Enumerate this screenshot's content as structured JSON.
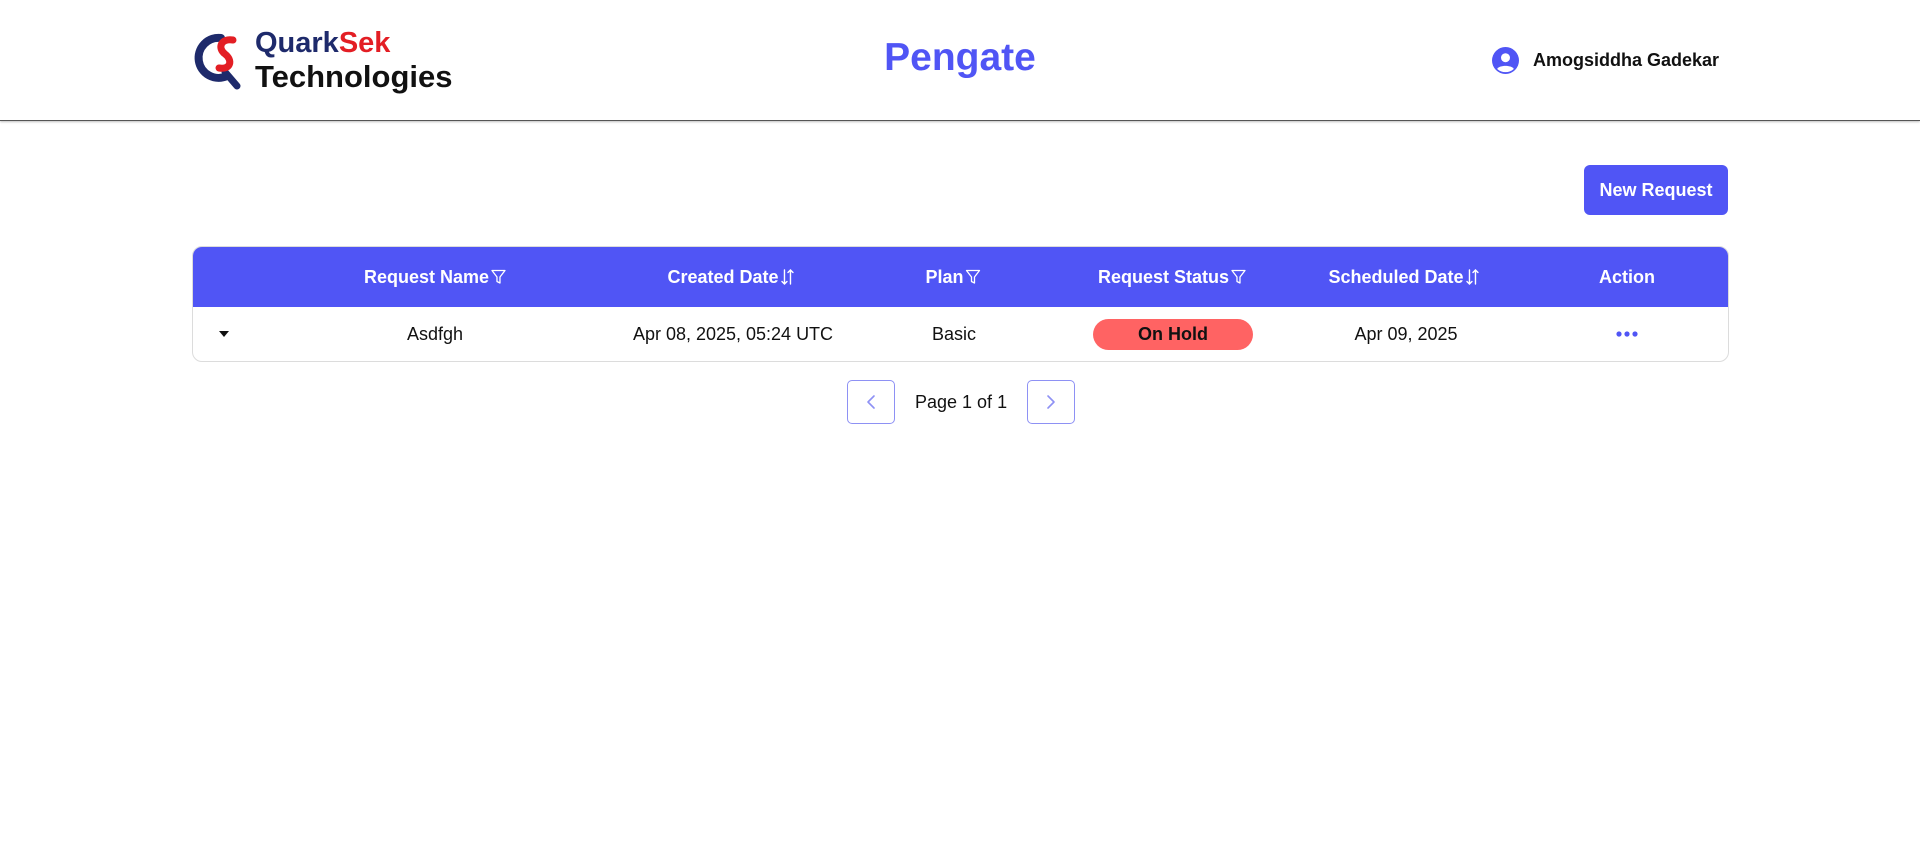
{
  "header": {
    "logo": {
      "brand_part1": "Quark",
      "brand_part2": "Sek",
      "brand_line2": "Technologies",
      "logo_icon": "qs-monogram-icon"
    },
    "app_title": "Pengate",
    "user": {
      "name": "Amogsiddha Gadekar",
      "icon": "user-circle-icon"
    }
  },
  "toolbar": {
    "new_request_label": "New Request"
  },
  "table": {
    "columns": [
      {
        "label": "Request Name",
        "icon": "filter-icon"
      },
      {
        "label": "Created Date",
        "icon": "sort-icon"
      },
      {
        "label": "Plan",
        "icon": "filter-icon"
      },
      {
        "label": "Request Status",
        "icon": "filter-icon"
      },
      {
        "label": "Scheduled Date",
        "icon": "sort-icon"
      },
      {
        "label": "Action",
        "icon": ""
      }
    ],
    "rows": [
      {
        "expand_icon": "caret-down-icon",
        "request_name": "Asdfgh",
        "created_date": "Apr 08, 2025, 05:24 UTC",
        "plan": "Basic",
        "status": "On Hold",
        "scheduled_date": "Apr 09, 2025",
        "action_icon": "more-horizontal-icon"
      }
    ]
  },
  "pagination": {
    "text": "Page 1 of 1",
    "prev_icon": "chevron-left-icon",
    "next_icon": "chevron-right-icon"
  },
  "colors": {
    "accent": "#5055f5",
    "status_on_hold": "#ff6363",
    "brand_navy": "#1e2a6b",
    "brand_red": "#e31e24"
  }
}
